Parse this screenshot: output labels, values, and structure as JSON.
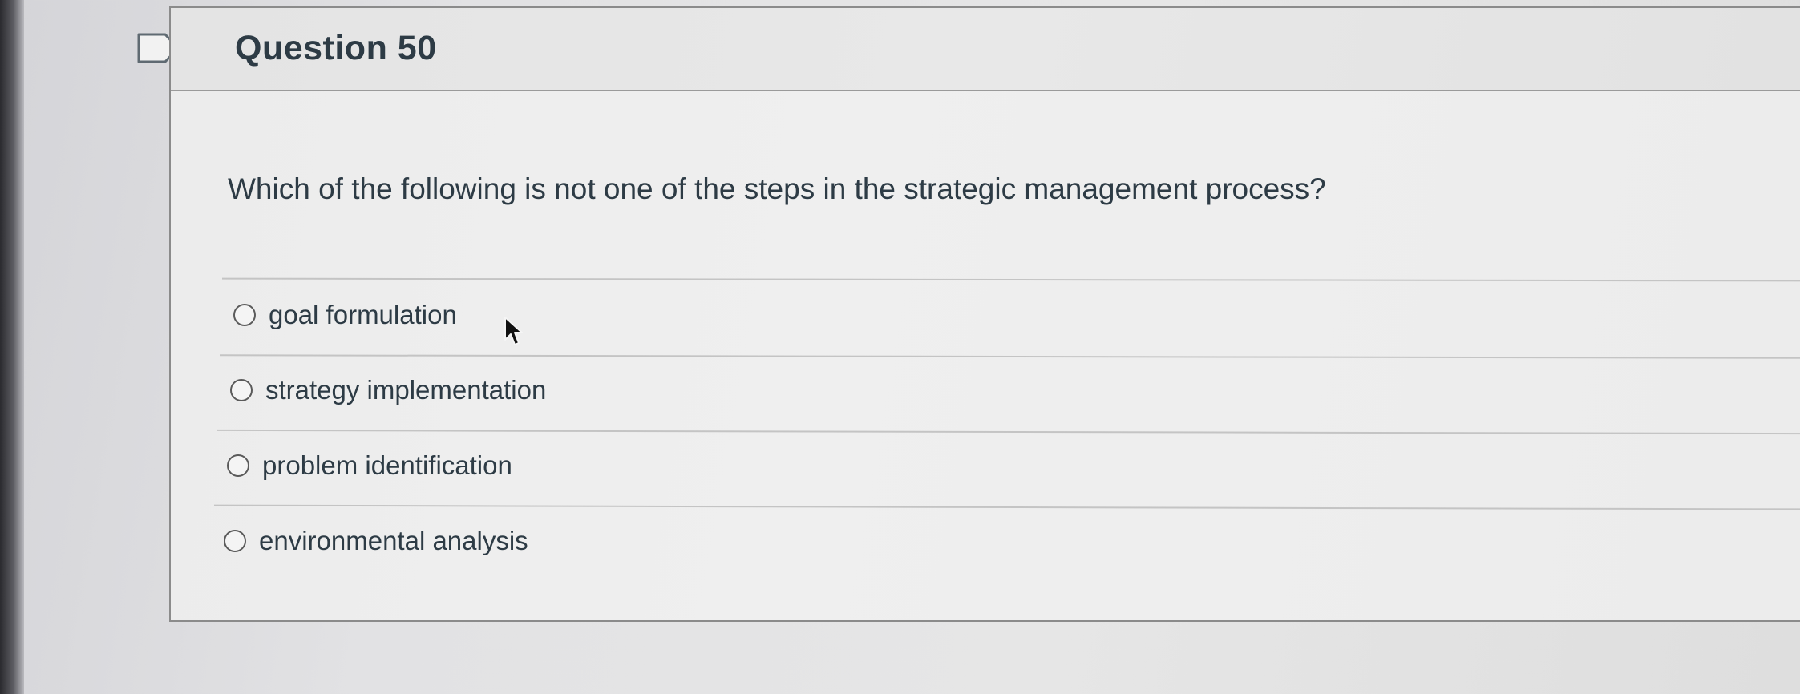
{
  "quiz": {
    "question_title": "Question 50",
    "question_text": "Which of the following is not one of the steps in the strategic management process?",
    "answers": [
      {
        "label": "goal formulation",
        "selected": false
      },
      {
        "label": "strategy implementation",
        "selected": false
      },
      {
        "label": "problem identification",
        "selected": false
      },
      {
        "label": "environmental analysis",
        "selected": false
      }
    ]
  },
  "icons": {
    "flag": "flag-question-icon",
    "cursor": "mouse-pointer-icon",
    "radio": "radio-button-icon"
  },
  "colors": {
    "text": "#2d3b45",
    "border": "#8b8b8b"
  }
}
